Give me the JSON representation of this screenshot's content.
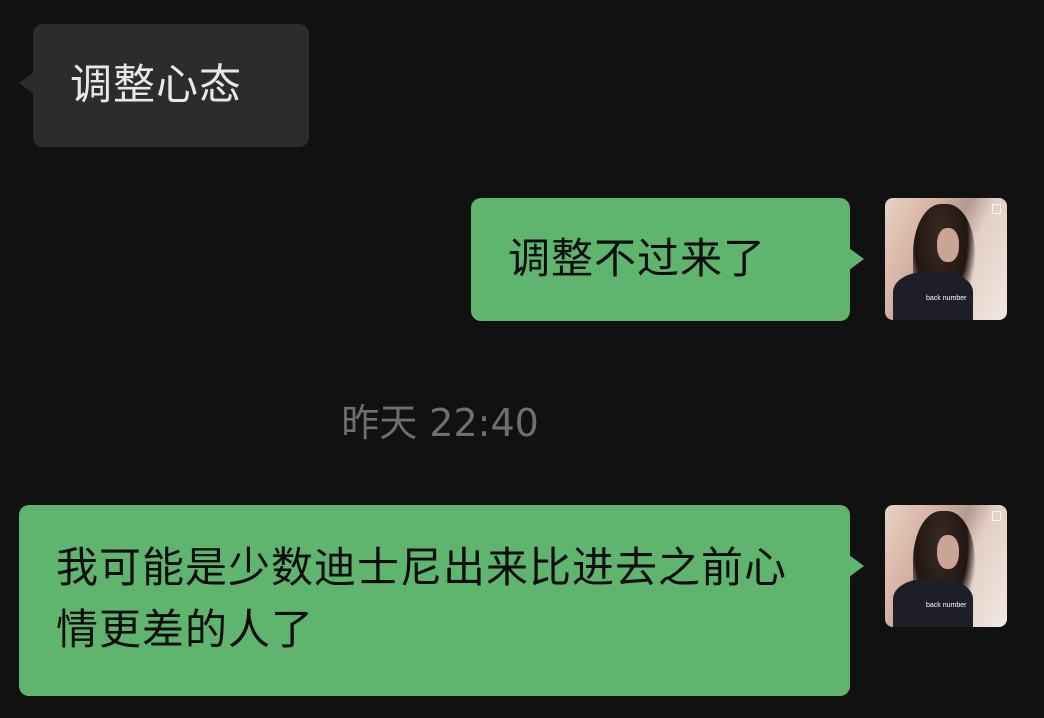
{
  "chat": {
    "messages": [
      {
        "direction": "incoming",
        "text": "调整心态"
      },
      {
        "direction": "outgoing",
        "text": "调整不过来了"
      },
      {
        "direction": "outgoing",
        "text": "我可能是少数迪士尼出来比进去之前心情更差的人了"
      }
    ],
    "timestamp": "昨天 22:40",
    "avatar_caption": "back number"
  },
  "colors": {
    "background": "#111111",
    "incoming_bubble": "#2c2c2c",
    "outgoing_bubble": "#5fb56e",
    "timestamp_text": "#6f6f6f"
  }
}
